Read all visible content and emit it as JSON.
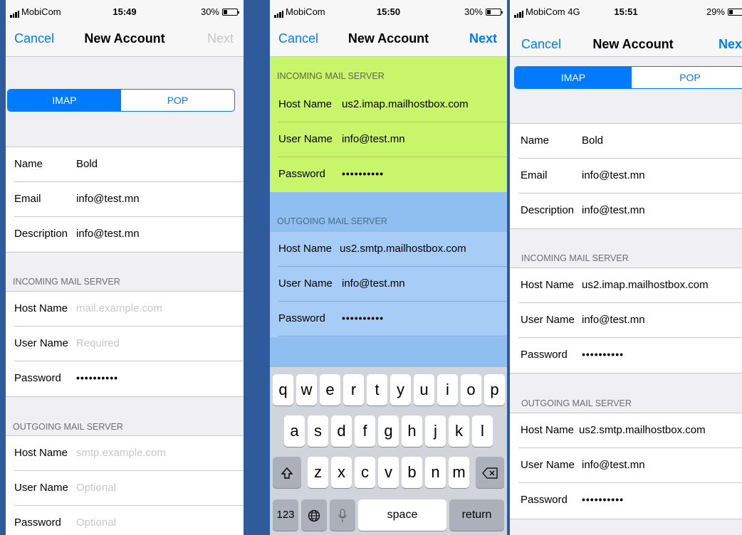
{
  "screens": [
    {
      "status": {
        "carrier": "MobiCom",
        "network": "",
        "time": "15:49",
        "battery": "30%",
        "battery_level": 0.3
      },
      "nav": {
        "left": "Cancel",
        "title": "New Account",
        "right": "Next",
        "right_enabled": false
      },
      "segment": {
        "options": [
          "IMAP",
          "POP"
        ],
        "selected": "IMAP"
      },
      "account": [
        {
          "label": "Name",
          "value": "Bold"
        },
        {
          "label": "Email",
          "value": "info@test.mn"
        },
        {
          "label": "Description",
          "value": "info@test.mn"
        }
      ],
      "incoming": {
        "header": "INCOMING MAIL SERVER",
        "rows": [
          {
            "label": "Host Name",
            "value": "mail.example.com",
            "placeholder": true
          },
          {
            "label": "User Name",
            "value": "Required",
            "placeholder": true
          },
          {
            "label": "Password",
            "value": "••••••••••",
            "placeholder": false
          }
        ]
      },
      "outgoing": {
        "header": "OUTGOING MAIL SERVER",
        "rows": [
          {
            "label": "Host Name",
            "value": "smtp.example.com",
            "placeholder": true
          },
          {
            "label": "User Name",
            "value": "Optional",
            "placeholder": true
          },
          {
            "label": "Password",
            "value": "Optional",
            "placeholder": true
          }
        ]
      }
    },
    {
      "status": {
        "carrier": "MobiCom",
        "network": "",
        "time": "15:50",
        "battery": "30%",
        "battery_level": 0.3
      },
      "nav": {
        "left": "Cancel",
        "title": "New Account",
        "right": "Next",
        "right_enabled": true
      },
      "incoming": {
        "header": "INCOMING MAIL SERVER",
        "highlight": "#c8f56a",
        "rows": [
          {
            "label": "Host Name",
            "value": "us2.imap.mailhostbox.com"
          },
          {
            "label": "User Name",
            "value": "info@test.mn"
          },
          {
            "label": "Password",
            "value": "••••••••••"
          }
        ]
      },
      "outgoing": {
        "header": "OUTGOING MAIL SERVER",
        "highlight": "#8fbff0",
        "rows": [
          {
            "label": "Host Name",
            "value": "us2.smtp.mailhostbox.com"
          },
          {
            "label": "User Name",
            "value": "info@test.mn"
          },
          {
            "label": "Password",
            "value": "••••••••••"
          }
        ]
      },
      "keyboard": {
        "row1": [
          "q",
          "w",
          "e",
          "r",
          "t",
          "y",
          "u",
          "i",
          "o",
          "p"
        ],
        "row2": [
          "a",
          "s",
          "d",
          "f",
          "g",
          "h",
          "j",
          "k",
          "l"
        ],
        "row3": [
          "z",
          "x",
          "c",
          "v",
          "b",
          "n",
          "m"
        ],
        "numbers": "123",
        "space": "space",
        "return": "return"
      }
    },
    {
      "status": {
        "carrier": "MobiCom",
        "network": "4G",
        "time": "15:51",
        "battery": "29%",
        "battery_level": 0.29
      },
      "nav": {
        "left": "Cancel",
        "title": "New Account",
        "right": "Next",
        "right_enabled": true
      },
      "segment": {
        "options": [
          "IMAP",
          "POP"
        ],
        "selected": "IMAP"
      },
      "account": [
        {
          "label": "Name",
          "value": "Bold"
        },
        {
          "label": "Email",
          "value": "info@test.mn"
        },
        {
          "label": "Description",
          "value": "info@test.mn"
        }
      ],
      "incoming": {
        "header": "INCOMING MAIL SERVER",
        "rows": [
          {
            "label": "Host Name",
            "value": "us2.imap.mailhostbox.com"
          },
          {
            "label": "User Name",
            "value": "info@test.mn"
          },
          {
            "label": "Password",
            "value": "••••••••••"
          }
        ]
      },
      "outgoing": {
        "header": "OUTGOING MAIL SERVER",
        "rows": [
          {
            "label": "Host Name",
            "value": "us2.smtp.mailhostbox.com"
          },
          {
            "label": "User Name",
            "value": "info@test.mn"
          },
          {
            "label": "Password",
            "value": "••••••••••"
          }
        ]
      }
    }
  ]
}
